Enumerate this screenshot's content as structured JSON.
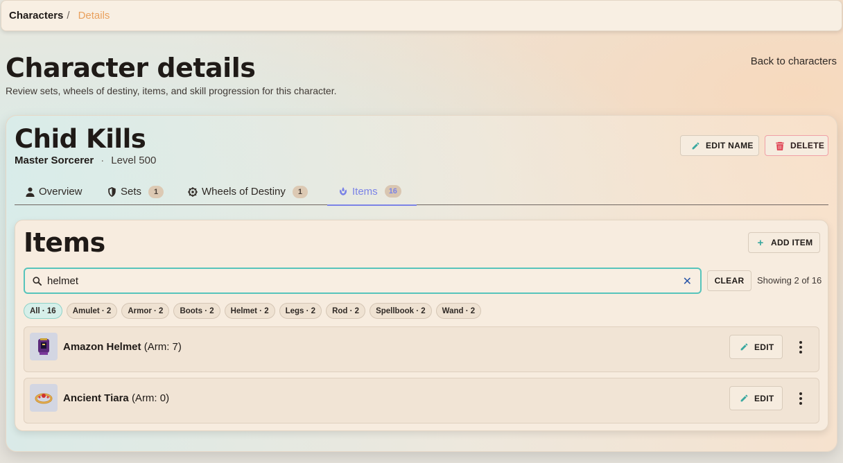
{
  "breadcrumb": {
    "root": "Characters",
    "separator": "/",
    "current": "Details"
  },
  "page": {
    "title": "Character details",
    "subtitle": "Review sets, wheels of destiny, items, and skill progression for this character.",
    "back_link": "Back to characters"
  },
  "character": {
    "name": "Chid Kills",
    "vocation": "Master Sorcerer",
    "separator": "·",
    "level": "Level 500",
    "edit_name_label": "EDIT NAME",
    "delete_label": "DELETE"
  },
  "tabs": [
    {
      "label": "Overview",
      "icon": "person-icon",
      "badge": ""
    },
    {
      "label": "Sets",
      "icon": "shield-icon",
      "badge": "1"
    },
    {
      "label": "Wheels of Destiny",
      "icon": "wheel-icon",
      "badge": "1"
    },
    {
      "label": "Items",
      "icon": "items-icon",
      "badge": "16",
      "active": true
    }
  ],
  "items_panel": {
    "title": "Items",
    "add_item_label": "ADD ITEM",
    "search_value": "helmet",
    "clear_label": "CLEAR",
    "showing": "Showing 2 of 16",
    "filters": [
      "All · 16",
      "Amulet · 2",
      "Armor · 2",
      "Boots · 2",
      "Helmet · 2",
      "Legs · 2",
      "Rod · 2",
      "Spellbook · 2",
      "Wand · 2"
    ],
    "active_filter": "All · 16",
    "items": [
      {
        "name": "Amazon Helmet",
        "detail": "(Arm: 7)",
        "icon": "helmet-icon",
        "edit_label": "EDIT"
      },
      {
        "name": "Ancient Tiara",
        "detail": "(Arm: 0)",
        "icon": "tiara-icon",
        "edit_label": "EDIT"
      }
    ]
  },
  "colors": {
    "accent": "#7b83e6",
    "teal": "#57c4bb",
    "danger": "#e04657",
    "breadcrumb_current": "#e9a05d"
  }
}
